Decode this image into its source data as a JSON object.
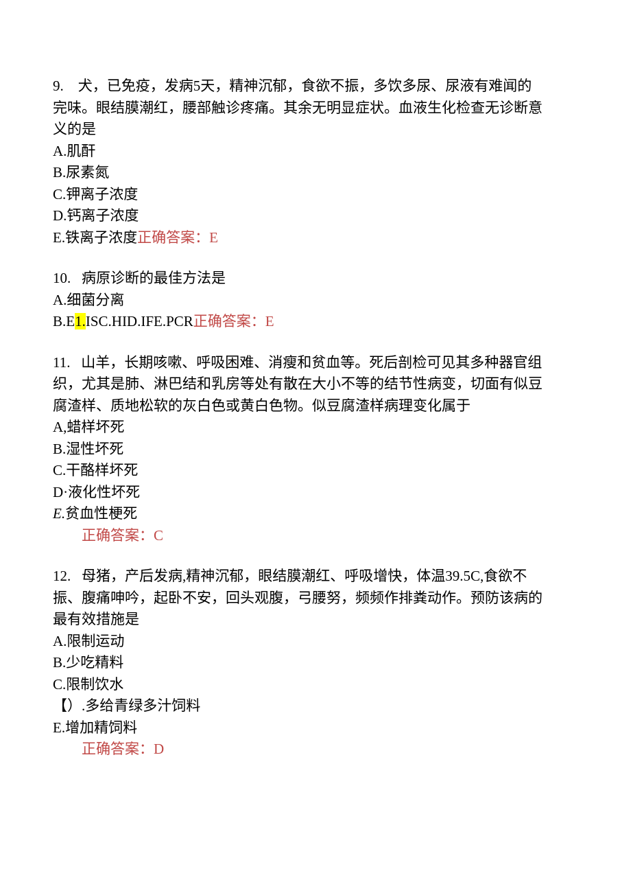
{
  "q9": {
    "num": "9.",
    "stem_l1": "犬，已免疫，发病5天，精神沉郁，食欲不振，多饮多尿、尿液有难闻的",
    "stem_l2": "完味。眼结膜潮红，腰部触诊疼痛。其余无明显症状。血液生化检查无诊断意",
    "stem_l3": "义的是",
    "optA": "A.肌酐",
    "optB": "B.尿素氮",
    "optC": "C.钾离子浓度",
    "optD": "D.钙离子浓度",
    "optE_text": "E.铁离子浓度",
    "answer": "正确答案：E"
  },
  "q10": {
    "num": "10.",
    "stem": "病原诊断的最佳方法是",
    "optA": "A.细菌分离",
    "optB_pre": "B.E",
    "optB_hl": "1.",
    "optB_post": "ISC.HID.IFE.PCR",
    "answer": "正确答案：E"
  },
  "q11": {
    "num": "11.",
    "stem_l1": "山羊，长期咳嗽、呼吸困难、消瘦和贫血等。死后剖检可见其多种器官组",
    "stem_l2": "织，尤其是肺、淋巴结和乳房等处有散在大小不等的结节性病变，切面有似豆",
    "stem_l3": "腐渣样、质地松软的灰白色或黄白色物。似豆腐渣样病理变化属于",
    "optA": "A,蜡样坏死",
    "optB": "B.湿性坏死",
    "optC": "C.干酪样坏死",
    "optD": "D·液化性坏死",
    "optE_pre": "E.",
    "optE_text": "贫血性梗死",
    "answer": "正确答案：C"
  },
  "q12": {
    "num": "12.",
    "stem_l1": "母猪，产后发病,精神沉郁，眼结膜潮红、呼吸增快，体温39.5C,食欲不",
    "stem_l2": "振、腹痛呻吟，起卧不安，回头观腹，弓腰努，频频作排粪动作。预防该病的",
    "stem_l3": "最有效措施是",
    "optA": "A.限制运动",
    "optB": "B.少吃精料",
    "optC": "C.限制饮水",
    "optD": "【）.多给青绿多汁饲料",
    "optE": "E.增加精饲料",
    "answer": "正确答案：D"
  }
}
